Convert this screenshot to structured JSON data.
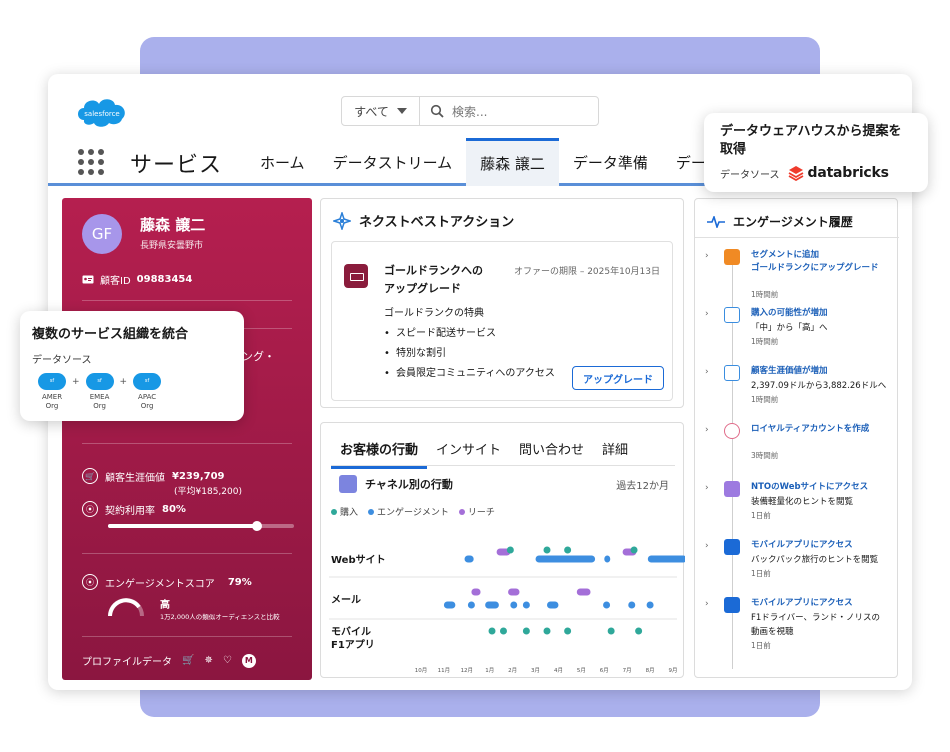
{
  "brand": {
    "logo_text": "salesforce"
  },
  "search": {
    "scope": "すべて",
    "placeholder": "検索..."
  },
  "app": {
    "name": "サービス"
  },
  "tabs": [
    {
      "label": "ホーム"
    },
    {
      "label": "データストリーム"
    },
    {
      "label": "藤森 譲二",
      "active": true
    },
    {
      "label": "データ準備"
    },
    {
      "label": "デー"
    }
  ],
  "profile": {
    "initials": "GF",
    "name": "藤森 譲二",
    "location": "長野県安曇野市",
    "customer_id_label": "顧客ID",
    "customer_id": "09883454",
    "partial_text_1": "ング・",
    "ltv_label": "顧客生涯価値",
    "ltv_value": "¥239,709",
    "ltv_avg": "(平均¥185,200)",
    "usage_label": "契約利用率",
    "usage_value": "80%",
    "usage_fraction": 0.8,
    "score_label": "エンゲージメントスコア",
    "score_value": "79%",
    "score_level": "高",
    "score_compare": "1万2,000人の類似オーディエンスと比較",
    "footer_label": "プロファイルデータ"
  },
  "next_best_action": {
    "title": "ネクストベストアクション",
    "offer_title_1": "ゴールドランクへの",
    "offer_title_2": "アップグレード",
    "offer_expiry": "オファーの期限 – 2025年10月13日",
    "benefits_title": "ゴールドランクの特典",
    "benefits": [
      "スピード配送サービス",
      "特別な割引",
      "会員限定コミュニティへのアクセス"
    ],
    "button": "アップグレード"
  },
  "behavior": {
    "tabs": [
      {
        "label": "お客様の行動",
        "active": true
      },
      {
        "label": "インサイト"
      },
      {
        "label": "問い合わせ"
      },
      {
        "label": "詳細"
      }
    ],
    "chart_title": "チャネル別の行動",
    "range": "過去12か月",
    "legend": [
      {
        "name": "購入",
        "color": "#2fa89a"
      },
      {
        "name": "エンゲージメント",
        "color": "#3d8ee0"
      },
      {
        "name": "リーチ",
        "color": "#a46fd8"
      }
    ]
  },
  "chart_data": {
    "type": "scatter",
    "x_ticks": [
      "10月",
      "11月",
      "12月",
      "1月",
      "2月",
      "3月",
      "4月",
      "5月",
      "6月",
      "7月",
      "8月",
      "9月"
    ],
    "rows": [
      {
        "label": "Webサイト",
        "points": [
          {
            "series": "購入",
            "x": 3.9
          },
          {
            "series": "購入",
            "x": 5.5
          },
          {
            "series": "購入",
            "x": 6.4
          },
          {
            "series": "購入",
            "x": 9.3
          }
        ],
        "ranges": [
          {
            "series": "エンゲージメント",
            "from": 1.9,
            "to": 2.3
          },
          {
            "series": "エンゲージメント",
            "from": 5.0,
            "to": 7.6
          },
          {
            "series": "エンゲージメント",
            "from": 8.0,
            "to": 8.2
          },
          {
            "series": "エンゲージメント",
            "from": 9.9,
            "to": 11.6
          },
          {
            "series": "リーチ",
            "from": 3.3,
            "to": 3.9
          },
          {
            "series": "リーチ",
            "from": 8.8,
            "to": 9.4
          }
        ]
      },
      {
        "label": "メール",
        "points": [
          {
            "series": "エンゲージメント",
            "x": 2.2
          },
          {
            "series": "エンゲージメント",
            "x": 4.6
          },
          {
            "series": "エンゲージメント",
            "x": 8.1
          },
          {
            "series": "エンゲージメント",
            "x": 9.2
          },
          {
            "series": "エンゲージメント",
            "x": 10.0
          }
        ],
        "ranges": [
          {
            "series": "エンゲージメント",
            "from": 1.0,
            "to": 1.5
          },
          {
            "series": "エンゲージメント",
            "from": 2.8,
            "to": 3.4
          },
          {
            "series": "エンゲージメント",
            "from": 3.9,
            "to": 4.2
          },
          {
            "series": "エンゲージメント",
            "from": 5.5,
            "to": 6.0
          },
          {
            "series": "リーチ",
            "from": 2.2,
            "to": 2.6
          },
          {
            "series": "リーチ",
            "from": 3.8,
            "to": 4.3
          },
          {
            "series": "リーチ",
            "from": 6.8,
            "to": 7.4
          }
        ]
      },
      {
        "label": "モバイル\nF1アプリ",
        "label_lines": [
          "モバイル",
          "F1アプリ"
        ],
        "points": [
          {
            "series": "購入",
            "x": 3.1
          },
          {
            "series": "購入",
            "x": 3.6
          },
          {
            "series": "購入",
            "x": 4.6
          },
          {
            "series": "購入",
            "x": 5.5
          },
          {
            "series": "購入",
            "x": 6.4
          },
          {
            "series": "購入",
            "x": 8.3
          },
          {
            "series": "購入",
            "x": 9.5
          }
        ],
        "ranges": []
      }
    ]
  },
  "engagement": {
    "title": "エンゲージメント履歴",
    "items": [
      {
        "icon": "segment-icon",
        "color": "#f08a24",
        "head_1": "セグメントに追加",
        "head_2": "ゴールドランクにアップグレード",
        "body": "",
        "time": "1時間前"
      },
      {
        "icon": "ai-icon",
        "color": "#3a8ddf",
        "head_1": "購入の可能性が増加",
        "head_2": "",
        "body": "「中」から「高」へ",
        "time": "1時間前"
      },
      {
        "icon": "ai-icon",
        "color": "#3a8ddf",
        "head_1": "顧客生涯価値が増加",
        "head_2": "",
        "body": "2,397.09ドルから3,882.26ドルへ",
        "time": "1時間前"
      },
      {
        "icon": "heart-icon",
        "color": "#e06c8a",
        "head_1": "ロイヤルティアカウントを作成",
        "head_2": "",
        "body": "",
        "time": "3時間前"
      },
      {
        "icon": "web-icon",
        "color": "#9d7ae0",
        "head_1": "NTOのWebサイトにアクセス",
        "head_2": "",
        "body": "装備軽量化のヒントを閲覧",
        "time": "1日前"
      },
      {
        "icon": "mobile-icon",
        "color": "#1b6ad6",
        "head_1": "モバイルアプリにアクセス",
        "head_2": "",
        "body": "バックパック旅行のヒントを閲覧",
        "time": "1日前"
      },
      {
        "icon": "mobile-icon",
        "color": "#1b6ad6",
        "head_1": "モバイルアプリにアクセス",
        "head_2": "",
        "body": "F1ドライバー、ランド・ノリスの",
        "body_2": "動画を視聴",
        "time": "1日前"
      }
    ]
  },
  "callout_dw": {
    "title_1": "データウェアハウスから提案を",
    "title_2": "取得",
    "source_label": "データソース",
    "brand": "databricks"
  },
  "callout_multi": {
    "title": "複数のサービス組織を統合",
    "source_label": "データソース",
    "orgs": [
      {
        "name": "AMER",
        "sub": "Org"
      },
      {
        "name": "EMEA",
        "sub": "Org"
      },
      {
        "name": "APAC",
        "sub": "Org"
      }
    ]
  }
}
